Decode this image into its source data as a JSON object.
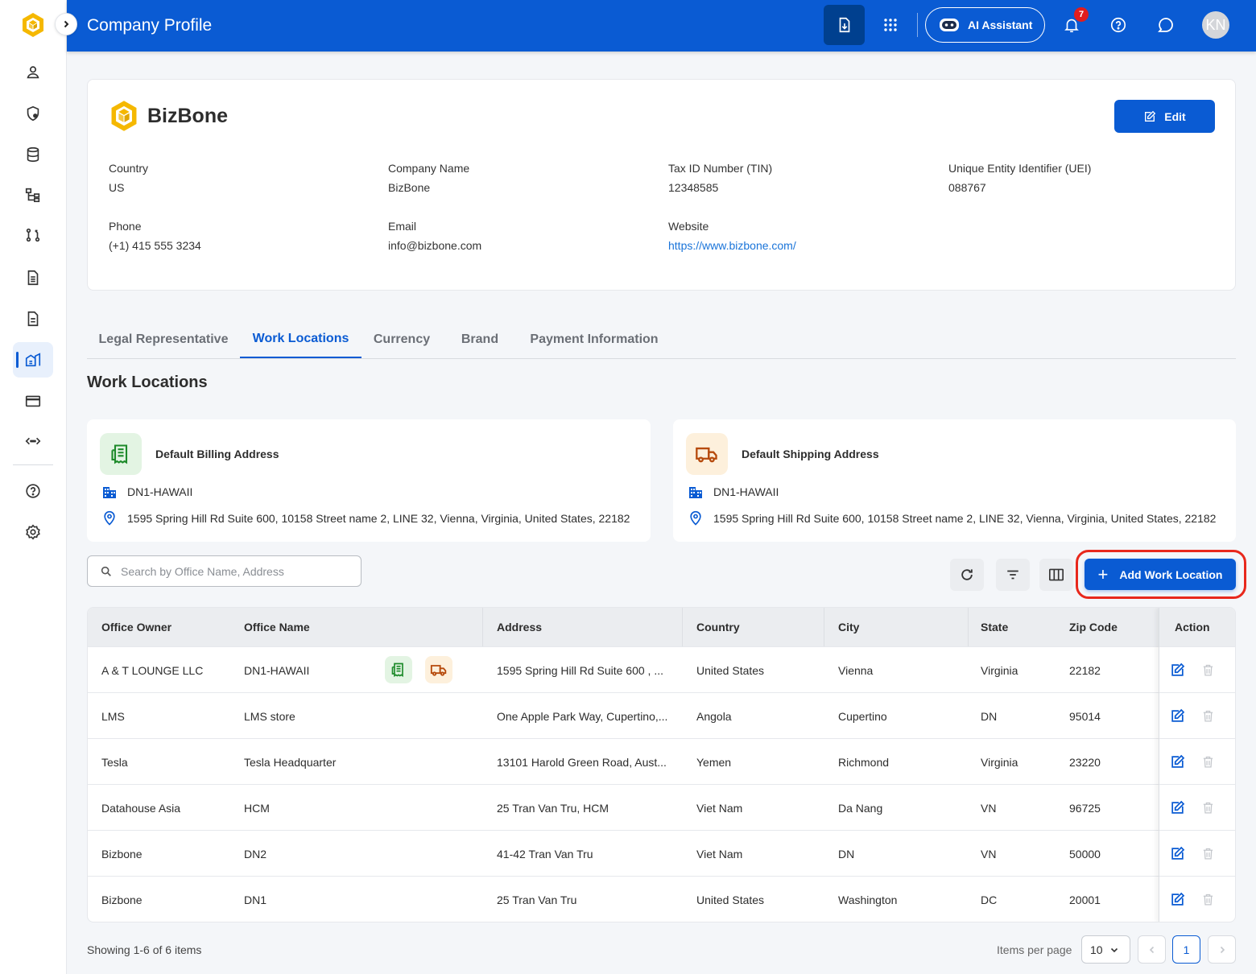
{
  "header": {
    "title": "Company Profile",
    "ai_assistant_label": "AI Assistant",
    "notification_count": "7",
    "avatar_initials": "KN"
  },
  "sidebar": {
    "items": [
      {
        "icon": "user-icon"
      },
      {
        "icon": "shield-user-icon"
      },
      {
        "icon": "database-icon"
      },
      {
        "icon": "org-chart-icon"
      },
      {
        "icon": "workflow-icon"
      },
      {
        "icon": "document-icon"
      },
      {
        "icon": "document-alt-icon"
      },
      {
        "icon": "company-icon",
        "active": true
      },
      {
        "icon": "card-icon"
      },
      {
        "icon": "integration-icon"
      },
      {
        "icon": "help-icon"
      },
      {
        "icon": "settings-icon"
      }
    ]
  },
  "company": {
    "name": "BizBone",
    "edit_label": "Edit",
    "fields": {
      "country_label": "Country",
      "country": "US",
      "company_name_label": "Company Name",
      "company_name": "BizBone",
      "tin_label": "Tax ID Number (TIN)",
      "tin": "12348585",
      "uei_label": "Unique Entity Identifier (UEI)",
      "uei": "088767",
      "phone_label": "Phone",
      "phone": "(+1) 415 555 3234",
      "email_label": "Email",
      "email": "info@bizbone.com",
      "website_label": "Website",
      "website": "https://www.bizbone.com/"
    }
  },
  "tabs": [
    {
      "label": "Legal Representative"
    },
    {
      "label": "Work Locations",
      "active": true
    },
    {
      "label": "Currency"
    },
    {
      "label": "Brand"
    },
    {
      "label": "Payment Information"
    }
  ],
  "section_title": "Work Locations",
  "billing": {
    "title": "Default Billing Address",
    "office": "DN1-HAWAII",
    "address": "1595 Spring Hill Rd Suite 600, 10158 Street name 2, LINE 32, Vienna, Virginia, United States, 22182"
  },
  "shipping": {
    "title": "Default Shipping Address",
    "office": "DN1-HAWAII",
    "address": "1595 Spring Hill Rd Suite 600, 10158 Street name 2, LINE 32, Vienna, Virginia, United States, 22182"
  },
  "search": {
    "placeholder": "Search by Office Name, Address"
  },
  "add_button_label": "Add Work Location",
  "table": {
    "columns": [
      "Office Owner",
      "Office Name",
      "Address",
      "Country",
      "City",
      "State",
      "Zip Code",
      "Action"
    ],
    "rows": [
      {
        "owner": "A & T LOUNGE LLC",
        "office": "DN1-HAWAII",
        "address": "1595 Spring Hill Rd Suite 600 , ...",
        "country": "United States",
        "city": "Vienna",
        "state": "Virginia",
        "zip": "22182"
      },
      {
        "owner": "LMS",
        "office": "LMS store",
        "address": "One Apple Park Way, Cupertino,...",
        "country": "Angola",
        "city": "Cupertino",
        "state": "DN",
        "zip": "95014"
      },
      {
        "owner": "Tesla",
        "office": "Tesla Headquarter",
        "address": "13101 Harold Green Road, Aust...",
        "country": "Yemen",
        "city": "Richmond",
        "state": "Virginia",
        "zip": "23220"
      },
      {
        "owner": "Datahouse Asia",
        "office": "HCM",
        "address": "25 Tran Van Tru, HCM",
        "country": "Viet Nam",
        "city": "Da Nang",
        "state": "VN",
        "zip": "96725"
      },
      {
        "owner": "Bizbone",
        "office": "DN2",
        "address": "41-42 Tran Van Tru",
        "country": "Viet Nam",
        "city": "DN",
        "state": "VN",
        "zip": "50000"
      },
      {
        "owner": "Bizbone",
        "office": "DN1",
        "address": "25 Tran Van Tru",
        "country": "United States",
        "city": "Washington",
        "state": "DC",
        "zip": "20001"
      }
    ]
  },
  "footer": {
    "showing": "Showing 1-6 of 6 items",
    "items_per_page_label": "Items per page",
    "items_per_page": "10",
    "current_page": "1"
  },
  "colors": {
    "primary": "#0a5bd3",
    "billing_bg": "#e3f4e3",
    "billing_icon": "#1d8a2a",
    "shipping_bg": "#fdf0dc",
    "shipping_icon": "#b64a0c",
    "highlight_ring": "#e8281c"
  }
}
